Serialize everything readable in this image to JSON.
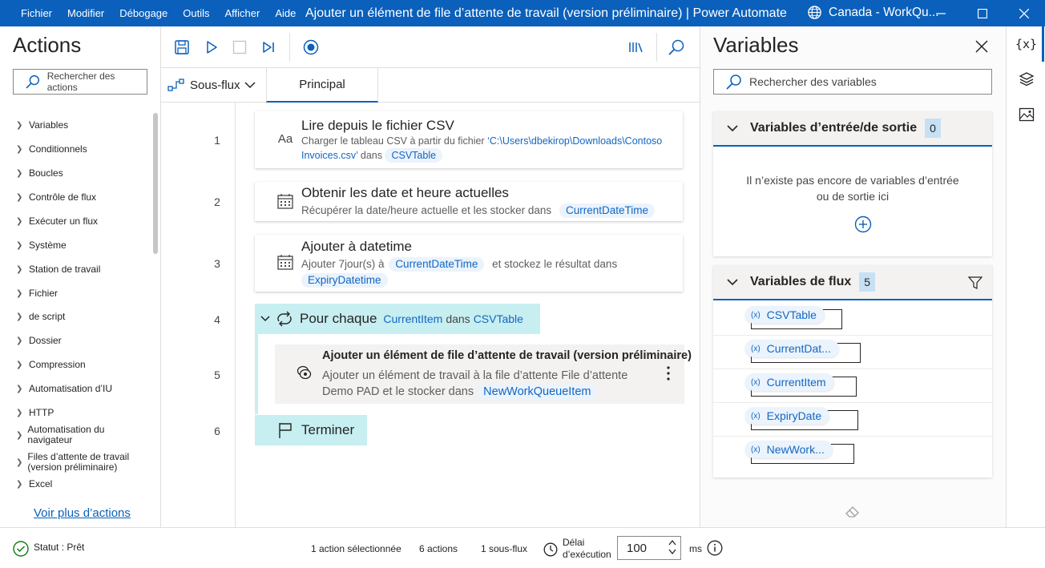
{
  "titlebar": {
    "menu": [
      "Fichier",
      "Modifier",
      "Débogage",
      "Outils",
      "Afficher",
      "Aide"
    ],
    "title": "Ajouter un élément de file d’attente de travail (version préliminaire) | Power Automate",
    "environment": "Canada - WorkQu..."
  },
  "actions": {
    "heading": "Actions",
    "search_placeholder": "Rechercher des actions",
    "items": [
      "Variables",
      "Conditionnels",
      "Boucles",
      "Contrôle de flux",
      "Exécuter un flux",
      "Système",
      "Station de travail",
      "Fichier",
      "de script",
      "Dossier",
      "Compression",
      "Automatisation d’IU",
      "HTTP",
      "Automatisation du navigateur",
      "Files d’attente de travail (version préliminaire)",
      "Excel"
    ],
    "more_link": "Voir plus d’actions"
  },
  "designer": {
    "subflow_label": "Sous-flux",
    "tab_main": "Principal",
    "line_numbers": [
      "1",
      "2",
      "3",
      "4",
      "5",
      "6"
    ],
    "steps": {
      "s1": {
        "title": "Lire depuis le fichier CSV",
        "desc_prefix": "Charger le tableau CSV à partir du fichier ",
        "path": "‘C:\\Users\\dbekirop\\Downloads\\Contoso Invoices.csv’",
        "mid": " dans ",
        "var": "CSVTable"
      },
      "s2": {
        "title": "Obtenir les date et heure actuelles",
        "desc_prefix": "Récupérer la date/heure actuelle et les stocker dans",
        "var": "CurrentDateTime"
      },
      "s3": {
        "title": "Ajouter à datetime",
        "desc_prefix": "Ajouter 7jour(s) à",
        "var1": "CurrentDateTime",
        "mid": "et stockez le résultat dans",
        "var2": "ExpiryDatetime"
      },
      "s4": {
        "title": "Pour chaque",
        "var1": "CurrentItem",
        "kw": "dans",
        "var2": "CSVTable"
      },
      "s5": {
        "title": "Ajouter un élément de file d’attente de travail (version préliminaire)",
        "desc_line1": "Ajouter un élément de travail à la file d’attente File d’attente",
        "desc_line2": "Demo PAD et le stocker dans",
        "var": "NewWorkQueueItem"
      },
      "s6": {
        "title": "Terminer"
      }
    }
  },
  "variables": {
    "heading": "Variables",
    "search_placeholder": "Rechercher des variables",
    "io_section": {
      "title": "Variables d’entrée/de sortie",
      "count": "0",
      "empty_text_line1": "Il n’existe pas encore de variables d’entrée",
      "empty_text_line2": "ou de sortie ici"
    },
    "flow_section": {
      "title": "Variables de flux",
      "count": "5",
      "items": [
        "CSVTable",
        "CurrentDat...",
        "CurrentItem",
        "ExpiryDate",
        "NewWork..."
      ],
      "var_prefix": "(x)"
    }
  },
  "rail": {
    "variables_icon_text": "{x}"
  },
  "statusbar": {
    "status": "Statut : Prêt",
    "selected": "1 action sélectionnée",
    "actions_count": "6 actions",
    "subflows": "1 sous-flux",
    "delay_line1": "Délai",
    "delay_line2": "d’exécution",
    "delay_value": "100",
    "delay_unit": "ms"
  },
  "colors": {
    "titlebar": "#0a60bb",
    "accent": "#0a60bb",
    "variable_pill": "#ebf3fc",
    "loop_block": "#c7eef0"
  }
}
